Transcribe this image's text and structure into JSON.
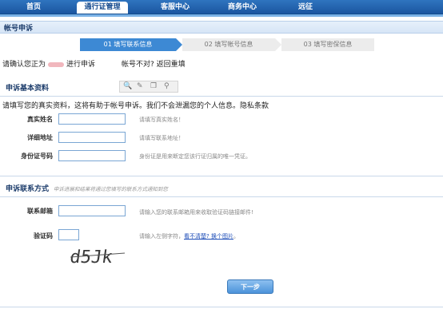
{
  "nav": {
    "tabs": [
      {
        "label": "首页"
      },
      {
        "label": "通行证管理"
      },
      {
        "label": "客服中心"
      },
      {
        "label": "商务中心"
      },
      {
        "label": "远征"
      }
    ]
  },
  "section_title": "帐号申诉",
  "steps": [
    {
      "label": "01 填写联系信息"
    },
    {
      "label": "02 填写帐号信息"
    },
    {
      "label": "03 填写密保信息"
    }
  ],
  "confirm": {
    "prefix": "请确认您正为",
    "suffix": "进行申诉",
    "mismatch": "帐号不对? 返回重填"
  },
  "basic": {
    "title": "申诉基本资料",
    "notice": "请填写您的真实资料，这将有助于帐号申诉。我们不会泄漏您的个人信息。隐私条款",
    "fields": [
      {
        "label": "真实姓名",
        "value": "",
        "hint": "请填写真实姓名！"
      },
      {
        "label": "详细地址",
        "value": "",
        "hint": "请填写联系地址！"
      },
      {
        "label": "身份证号码",
        "value": "",
        "hint": "身份证是用来断定您该行证归属的唯一凭证。"
      }
    ]
  },
  "contact": {
    "title": "申诉联系方式",
    "subtitle": "申诉进展和结果将通过您填写的联系方式通知到您",
    "email": {
      "label": "联系邮箱",
      "value": "",
      "hint": "请输入您的联系邮箱用来收取验证码链接邮件!"
    },
    "captcha": {
      "label": "验证码",
      "value": "",
      "hint": "请输入左侧字符，",
      "link": "看不清楚? 换个图片",
      "tail": "。",
      "image_text": "d5Jk"
    }
  },
  "next_button": "下一步",
  "colors": {
    "nav": "#1b56a0",
    "accent": "#3d89d4",
    "section": "#d6e5f6"
  }
}
